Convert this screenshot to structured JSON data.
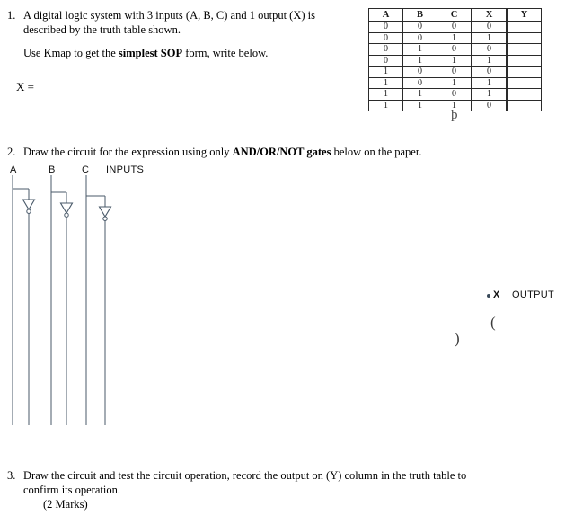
{
  "questions": [
    {
      "number": "1.",
      "line1": "A digital logic system with 3 inputs (A, B, C) and 1 output (X) is",
      "line2": "described by the truth table shown.",
      "kmap_pre": "Use Kmap to get the ",
      "kmap_bold": "simplest SOP",
      "kmap_post": " form, write below.",
      "answer_label": "X ="
    },
    {
      "number": "2.",
      "pre": "Draw the circuit for the expression using only ",
      "bold": "AND/OR/NOT gates",
      "post": " below on the paper."
    },
    {
      "number": "3.",
      "line1": "Draw the circuit and test the circuit operation, record the output on (Y) column in the truth table to",
      "line2": "confirm its operation.",
      "marks": "(2 Marks)"
    }
  ],
  "truth_table": {
    "headers": [
      "A",
      "B",
      "C",
      "X",
      "Y"
    ],
    "rows": [
      [
        "0",
        "0",
        "0",
        "0",
        ""
      ],
      [
        "0",
        "0",
        "1",
        "1",
        ""
      ],
      [
        "0",
        "1",
        "0",
        "0",
        ""
      ],
      [
        "0",
        "1",
        "1",
        "1",
        ""
      ],
      [
        "1",
        "0",
        "0",
        "0",
        ""
      ],
      [
        "1",
        "0",
        "1",
        "1",
        ""
      ],
      [
        "1",
        "1",
        "0",
        "1",
        ""
      ],
      [
        "1",
        "1",
        "1",
        "0",
        ""
      ]
    ]
  },
  "circuit": {
    "input_labels": [
      "A",
      "B",
      "C"
    ],
    "inputs_caption": "INPUTS",
    "output_caption": "OUTPUT",
    "output_signal": "X",
    "line_color": "#4a5a6a",
    "gate_type": "NOT",
    "inverter_count": 3
  },
  "stray_marks": {
    "below_table": "þ",
    "paren_open": "(",
    "paren_close": ")"
  }
}
